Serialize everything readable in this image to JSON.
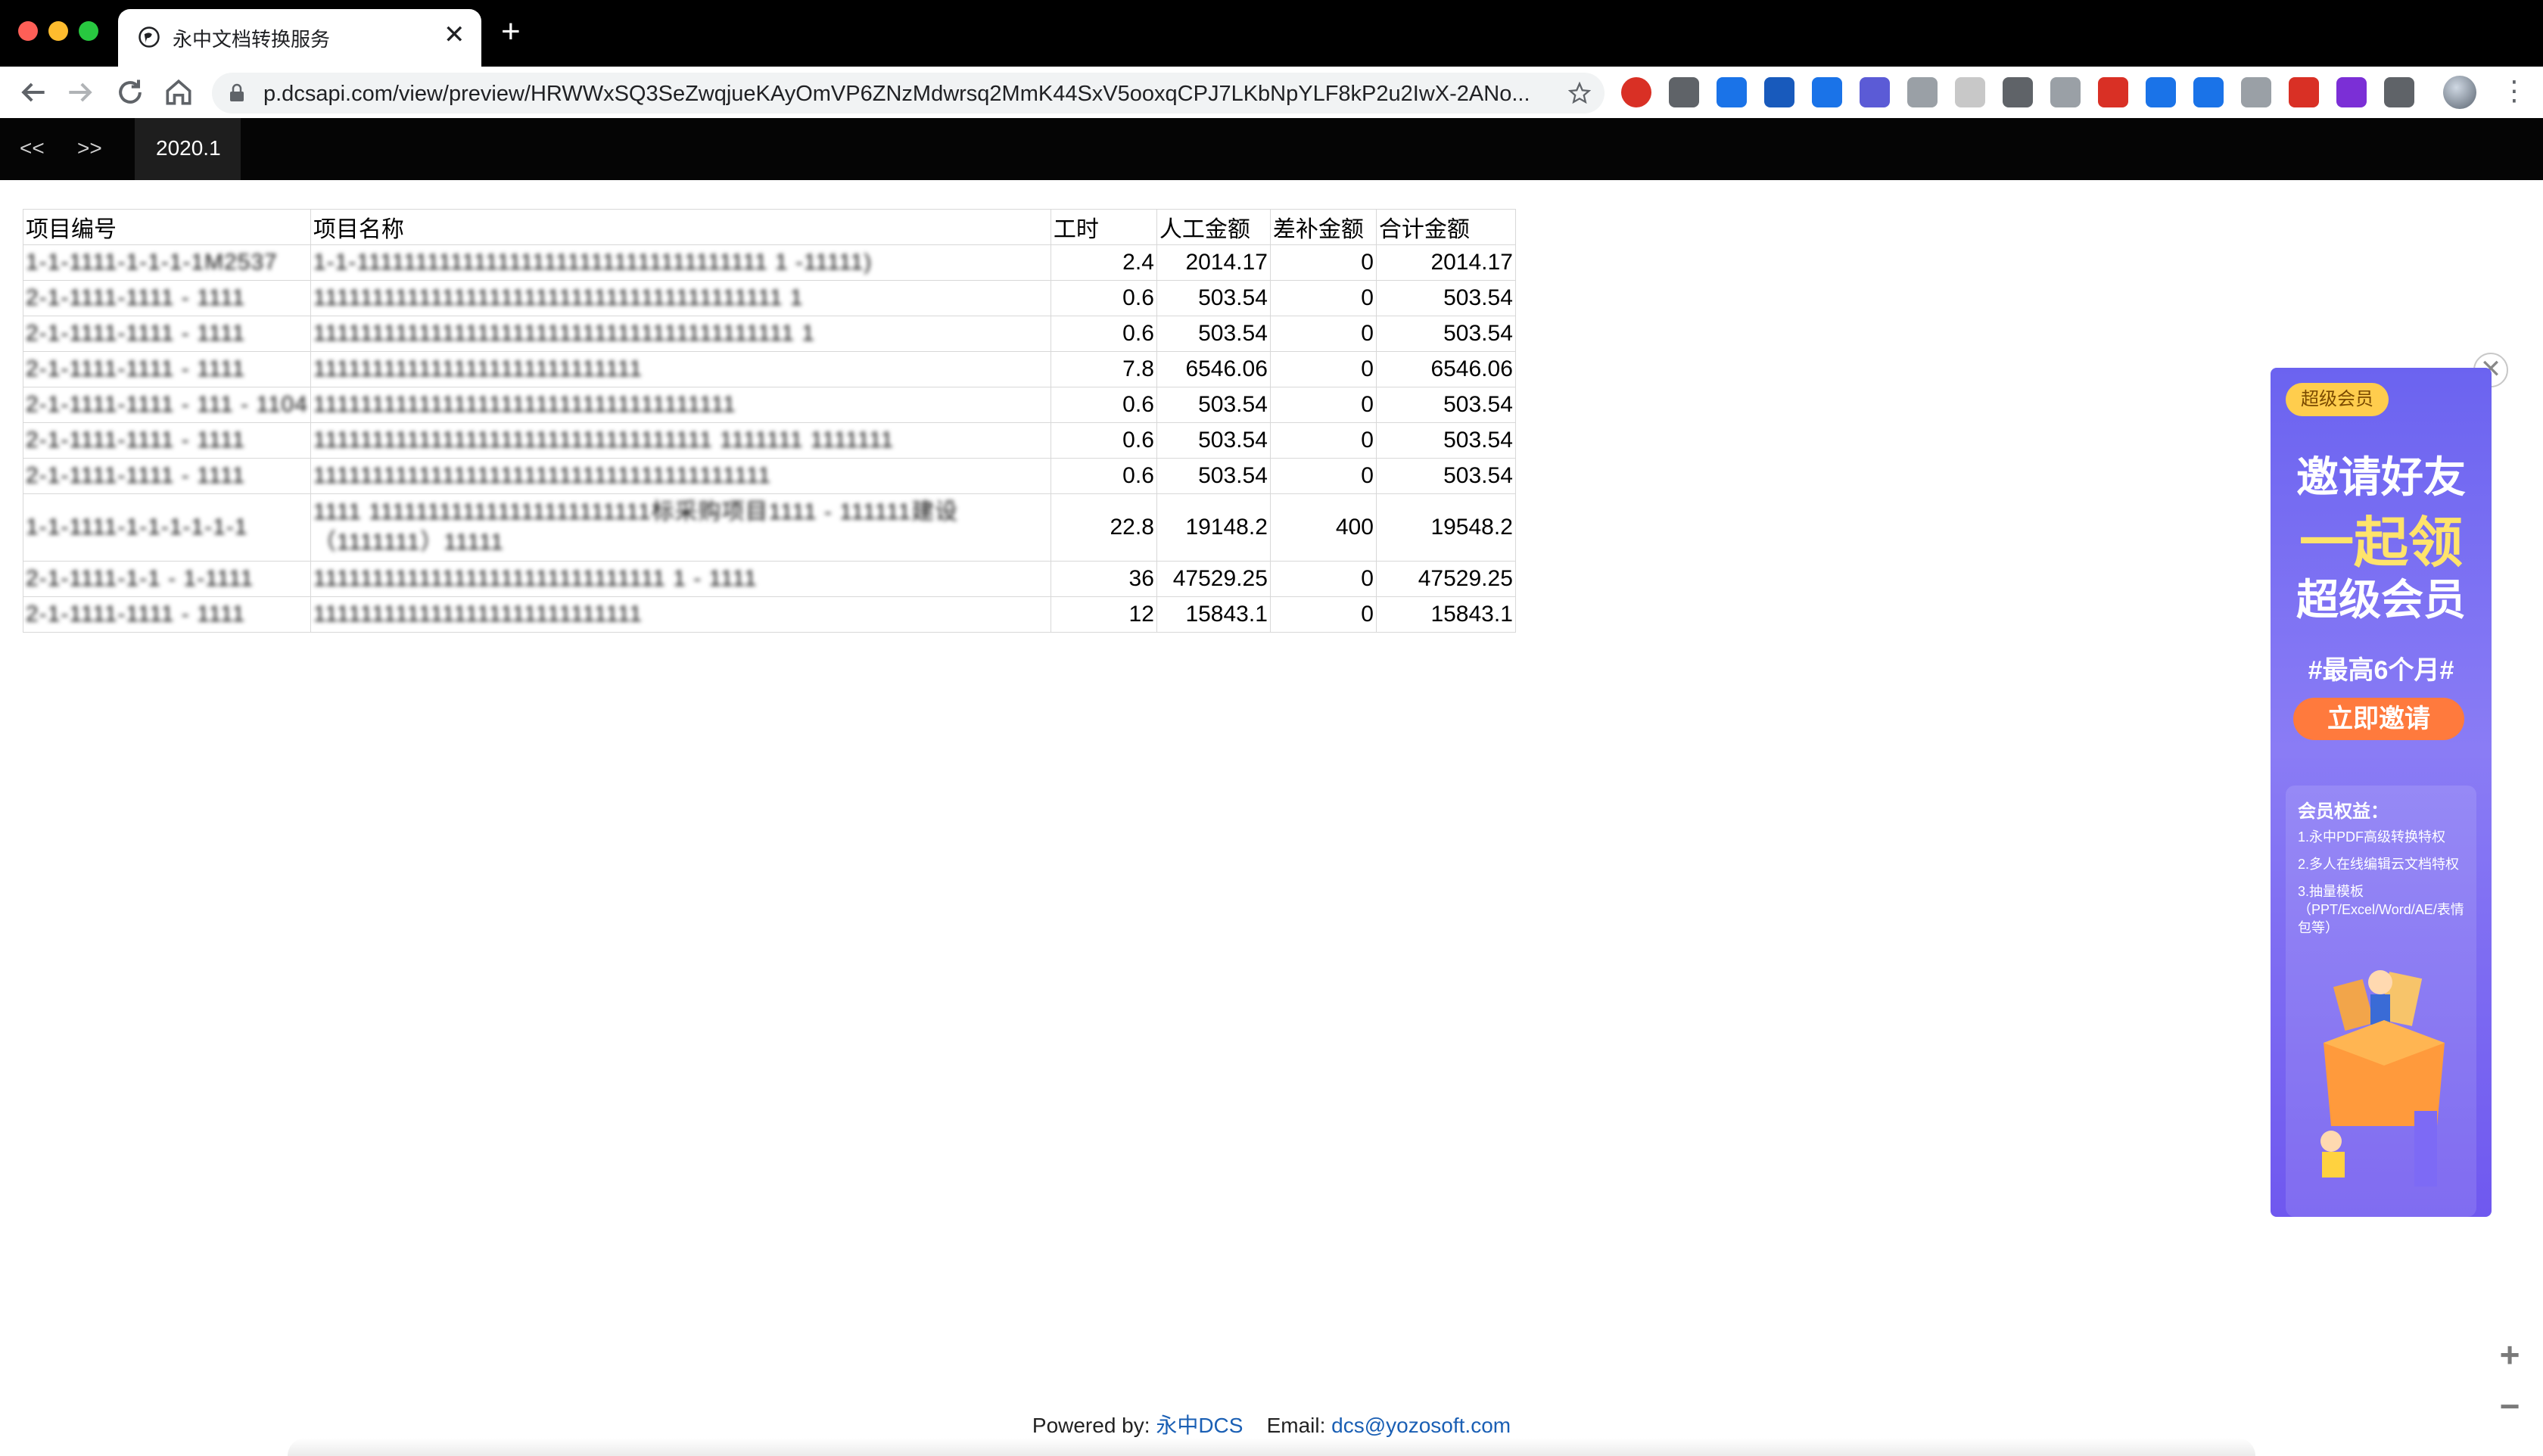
{
  "browser": {
    "tab_title": "永中文档转换服务",
    "new_tab_label": "+",
    "tab_close_label": "✕",
    "url": "p.dcsapi.com/view/preview/HRWWxSQ3SeZwqjueKAyOmVP6ZNzMdwrsq2MmK44SxV5ooxqCPJ7LKbNpYLF8kP2u2IwX-2ANo...",
    "extensions": [
      "opera-icon",
      "link-icon",
      "download-icon",
      "word-icon",
      "edit-icon",
      "check-icon",
      "reader-icon",
      "grid-icon",
      "vue-icon",
      "cursor-icon",
      "pdf-icon",
      "stack-icon",
      "translate-icon",
      "doc-icon",
      "pin-icon",
      "rp-icon",
      "puzzle-icon"
    ]
  },
  "viewer_nav": {
    "prev_label": "<<",
    "next_label": ">>",
    "sheet_tab": "2020.1"
  },
  "table": {
    "headers": [
      "项目编号",
      "项目名称",
      "工时",
      "人工金额",
      "差补金额",
      "合计金额"
    ],
    "rows": [
      {
        "id": "1-1-1111-1-1-1-1M2537",
        "name": "1-1-11111111111111111111111111111111111 1 -11111)",
        "hours": "2.4",
        "labor": "2014.17",
        "subsidy": "0",
        "total": "2014.17"
      },
      {
        "id": "2-1-1111-1111 - 1111",
        "name": "1111111111111111111111111111111111111111 1",
        "hours": "0.6",
        "labor": "503.54",
        "subsidy": "0",
        "total": "503.54"
      },
      {
        "id": "2-1-1111-1111 - 1111",
        "name": "11111111111111111111111111111111111111111 1",
        "hours": "0.6",
        "labor": "503.54",
        "subsidy": "0",
        "total": "503.54"
      },
      {
        "id": "2-1-1111-1111 - 1111",
        "name": "1111111111111111111111111111",
        "hours": "7.8",
        "labor": "6546.06",
        "subsidy": "0",
        "total": "6546.06"
      },
      {
        "id": "2-1-1111-1111 - 111 - 1104",
        "name": "111111111111111111111111111111111111",
        "hours": "0.6",
        "labor": "503.54",
        "subsidy": "0",
        "total": "503.54"
      },
      {
        "id": "2-1-1111-1111 - 1111",
        "name": "1111111111111111111111111111111111 1111111 1111111",
        "hours": "0.6",
        "labor": "503.54",
        "subsidy": "0",
        "total": "503.54"
      },
      {
        "id": "2-1-1111-1111 - 1111",
        "name": "111111111111111111111111111111111111111",
        "hours": "0.6",
        "labor": "503.54",
        "subsidy": "0",
        "total": "503.54"
      },
      {
        "id": "1-1-1111-1-1-1-1-1-1",
        "name": "1111 111111111111111111111111标采购项目1111 - 111111建设（1111111）11111",
        "hours": "22.8",
        "labor": "19148.2",
        "subsidy": "400",
        "total": "19548.2"
      },
      {
        "id": "2-1-1111-1-1 - 1-1111",
        "name": "111111111111111111111111111111 1 - 1111",
        "hours": "36",
        "labor": "47529.25",
        "subsidy": "0",
        "total": "47529.25"
      },
      {
        "id": "2-1-1111-1111 - 1111",
        "name": "1111111111111111111111111111",
        "hours": "12",
        "labor": "15843.1",
        "subsidy": "0",
        "total": "15843.1"
      }
    ]
  },
  "ad": {
    "badge": "超级会员",
    "headline_1": "邀请好友",
    "headline_2": "一起领",
    "headline_3": "超级会员",
    "tagline": "#最高6个月#",
    "cta": "立即邀请",
    "benefits_title": "会员权益：",
    "benefits": [
      "1.永中PDF高级转换特权",
      "2.多人在线编辑云文档特权",
      "3.抽量模板（PPT/Excel/Word/AE/表情包等）"
    ],
    "close_label": "✕"
  },
  "zoom": {
    "in_label": "+",
    "out_label": "−"
  },
  "footer": {
    "powered_label": "Powered by:",
    "powered_link": "永中DCS",
    "email_label": "Email:",
    "email_link": "dcs@yozosoft.com"
  },
  "colors": {
    "nav_bg": "#050505",
    "link": "#1a5fb4",
    "ad_purple": "#6b63f0",
    "cta_orange": "#ff7a3d"
  }
}
